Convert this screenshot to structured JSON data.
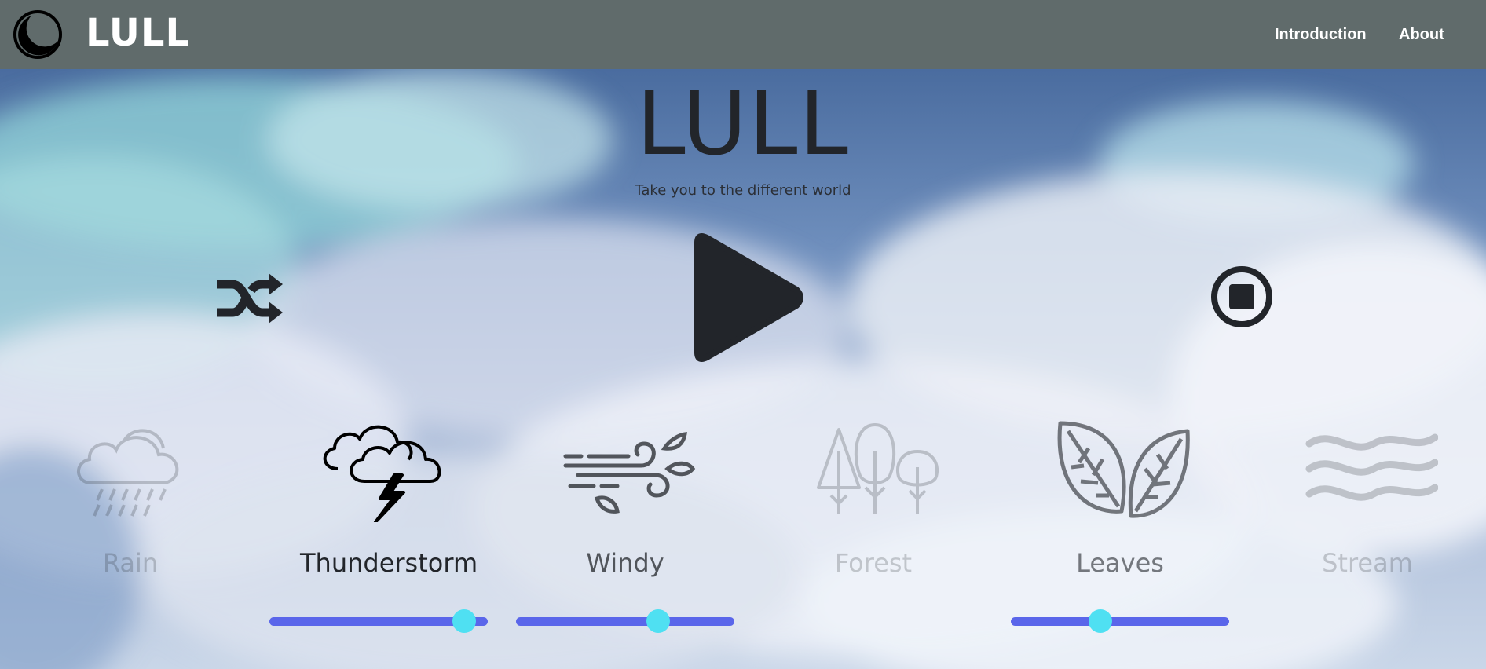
{
  "nav": {
    "brand": "LULL",
    "links": [
      "Introduction",
      "About"
    ]
  },
  "hero": {
    "title": "LULL",
    "subtitle": "Take you to the different world"
  },
  "controls": {
    "shuffle_icon": "shuffle-icon",
    "play_icon": "play-icon",
    "stop_icon": "stop-circle-icon"
  },
  "sounds": [
    {
      "label": "Rain",
      "icon": "rain-cloud-icon",
      "active": false
    },
    {
      "label": "Thunderstorm",
      "icon": "thunderstorm-icon",
      "active": true,
      "volume": 0.94
    },
    {
      "label": "Windy",
      "icon": "wind-icon",
      "active": true,
      "volume": 0.67
    },
    {
      "label": "Forest",
      "icon": "forest-trees-icon",
      "active": false
    },
    {
      "label": "Leaves",
      "icon": "leaves-icon",
      "active": true,
      "volume": 0.4
    },
    {
      "label": "Stream",
      "icon": "stream-waves-icon",
      "active": false
    }
  ],
  "colors": {
    "navbar": "#606b6b",
    "slider_track": "#5a66ea",
    "slider_thumb": "#4fe0f2",
    "text_dark": "#22252a"
  }
}
